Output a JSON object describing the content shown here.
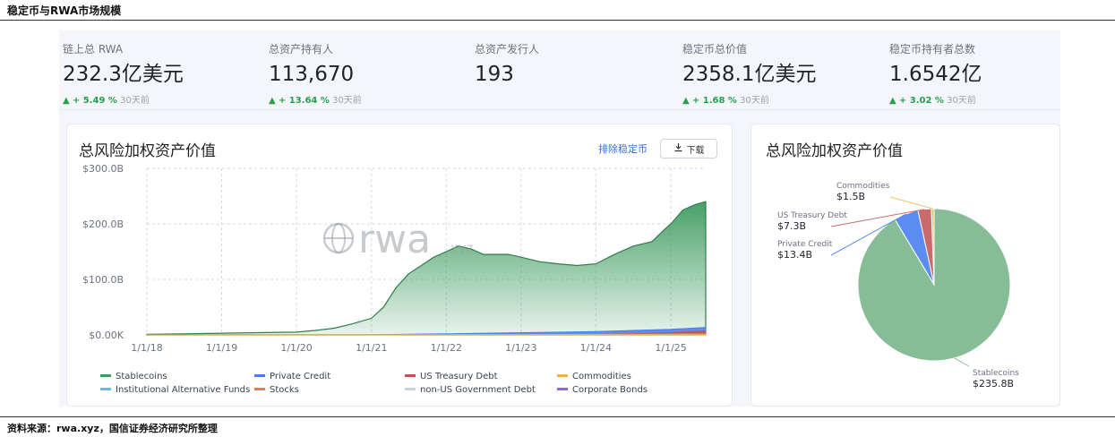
{
  "figure": {
    "title": "稳定币与RWA市场规模",
    "source": "资料来源：rwa.xyz，国信证券经济研究所整理"
  },
  "stats": [
    {
      "label": "链上总 RWA",
      "value": "232.3亿美元",
      "arrow": "▲",
      "change": "+ 5.49 %",
      "period": "30天前"
    },
    {
      "label": "总资产持有人",
      "value": "113,670",
      "arrow": "▲",
      "change": "+ 13.64 %",
      "period": "30天前"
    },
    {
      "label": "总资产发行人",
      "value": "193",
      "arrow": "",
      "change": "",
      "period": ""
    },
    {
      "label": "稳定币总价值",
      "value": "2358.1亿美元",
      "arrow": "▲",
      "change": "+ 1.68 %",
      "period": "30天前"
    },
    {
      "label": "稳定币持有者总数",
      "value": "1.6542亿",
      "arrow": "▲",
      "change": "+ 3.02 %",
      "period": "30天前"
    }
  ],
  "line_card": {
    "title": "总风险加权资产价值",
    "exclude_label": "排除稳定币",
    "download_label": "下载",
    "download_icon": "download-icon",
    "watermark": "rwa",
    "watermark_suffix": ".xyz"
  },
  "pie_card": {
    "title": "总风险加权资产价值"
  },
  "colors": {
    "stablecoins": "#3e9b5f",
    "private_credit": "#4a7be8",
    "us_treasury": "#c05454",
    "commodities": "#e7b547",
    "institutional": "#5bc0eb",
    "stocks": "#ee7a4a",
    "non_us_gov": "#c6d3e3",
    "corporate_bonds": "#9c5ce6",
    "pie_stablecoins": "#86bd96",
    "pie_private_credit": "#5b8cf0",
    "pie_us_treasury": "#c96b6b",
    "pie_commodities": "#e8c36a",
    "positive": "#22a34a"
  },
  "chart_data": [
    {
      "type": "area",
      "title": "总风险加权资产价值",
      "x_ticks": [
        "1/1/18",
        "1/1/19",
        "1/1/20",
        "1/1/21",
        "1/1/22",
        "1/1/23",
        "1/1/24",
        "1/1/25"
      ],
      "y_ticks": [
        "$300.0B",
        "$200.0B",
        "$100.0B",
        "$0.00K"
      ],
      "ylim": [
        0,
        300
      ],
      "yunit": "B USD",
      "stacked": true,
      "series": [
        {
          "name": "Stablecoins",
          "x": [
            "2018-01-01",
            "2018-07-01",
            "2019-01-01",
            "2019-07-01",
            "2020-01-01",
            "2020-04-01",
            "2020-07-01",
            "2020-10-01",
            "2021-01-01",
            "2021-03-01",
            "2021-05-01",
            "2021-07-01",
            "2021-09-01",
            "2021-11-01",
            "2022-01-01",
            "2022-03-01",
            "2022-05-01",
            "2022-07-01",
            "2022-09-01",
            "2022-11-01",
            "2023-01-01",
            "2023-04-01",
            "2023-07-01",
            "2023-10-01",
            "2024-01-01",
            "2024-04-01",
            "2024-07-01",
            "2024-10-01",
            "2024-12-01",
            "2025-01-01",
            "2025-03-01",
            "2025-05-01",
            "2025-06-20"
          ],
          "values": [
            1,
            2,
            3,
            4,
            5,
            8,
            12,
            20,
            30,
            50,
            85,
            110,
            125,
            140,
            150,
            160,
            155,
            145,
            145,
            145,
            140,
            132,
            128,
            125,
            128,
            145,
            160,
            168,
            190,
            200,
            225,
            235,
            240
          ]
        },
        {
          "name": "Private Credit",
          "x": [
            "2018-01-01",
            "2021-01-01",
            "2022-01-01",
            "2023-01-01",
            "2024-01-01",
            "2025-01-01",
            "2025-06-20"
          ],
          "values": [
            0,
            0.5,
            2,
            4,
            6,
            10,
            13.4
          ]
        },
        {
          "name": "US Treasury Debt",
          "x": [
            "2018-01-01",
            "2022-01-01",
            "2023-01-01",
            "2024-01-01",
            "2025-01-01",
            "2025-06-20"
          ],
          "values": [
            0,
            0,
            0.3,
            0.8,
            4,
            7.3
          ]
        },
        {
          "name": "Commodities",
          "x": [
            "2018-01-01",
            "2022-01-01",
            "2024-01-01",
            "2025-06-20"
          ],
          "values": [
            0,
            0.5,
            1,
            1.5
          ]
        }
      ],
      "legend": [
        "Stablecoins",
        "Private Credit",
        "US Treasury Debt",
        "Commodities",
        "Institutional Alternative Funds",
        "Stocks",
        "non-US Government Debt",
        "Corporate Bonds"
      ],
      "legend_position": "bottom",
      "grid": true
    },
    {
      "type": "pie",
      "title": "总风险加权资产价值",
      "slices": [
        {
          "label": "Stablecoins",
          "value": 235.8,
          "display": "$235.8B"
        },
        {
          "label": "Private Credit",
          "value": 13.4,
          "display": "$13.4B"
        },
        {
          "label": "US Treasury Debt",
          "value": 7.3,
          "display": "$7.3B"
        },
        {
          "label": "Commodities",
          "value": 1.5,
          "display": "$1.5B"
        }
      ]
    }
  ]
}
